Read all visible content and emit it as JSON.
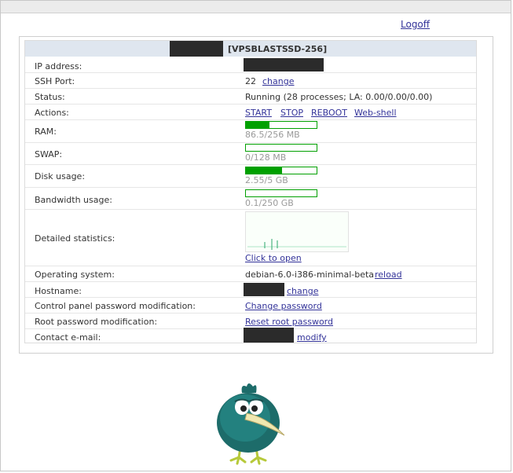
{
  "header": {
    "logoff": "Logoff",
    "vps_name": "[VPSBLASTSSD-256]"
  },
  "rows": {
    "ip": {
      "label": "IP address:"
    },
    "ssh": {
      "label": "SSH Port:",
      "value": "22",
      "change": "change"
    },
    "status": {
      "label": "Status:",
      "value": "Running (28 processes; LA: 0.00/0.00/0.00)"
    },
    "actions": {
      "label": "Actions:",
      "start": "START",
      "stop": "STOP",
      "reboot": "REBOOT",
      "webshell": "Web-shell"
    },
    "ram": {
      "label": "RAM:",
      "text": "86.5/256 MB",
      "used_fraction": 0.338
    },
    "swap": {
      "label": "SWAP:",
      "text": "0/128 MB",
      "used_fraction": 0.0
    },
    "disk": {
      "label": "Disk usage:",
      "text": "2.55/5 GB",
      "used_fraction": 0.51
    },
    "bandwidth": {
      "label": "Bandwidth usage:",
      "text": "0.1/250 GB",
      "used_fraction": 0.0004
    },
    "stats": {
      "label": "Detailed statistics:",
      "open": "Click to open"
    },
    "os": {
      "label": "Operating system:",
      "value": "debian-6.0-i386-minimal-beta",
      "reload": "reload"
    },
    "hostname": {
      "label": "Hostname:",
      "change": "change"
    },
    "cp_password": {
      "label": "Control panel password modification:",
      "link": "Change password"
    },
    "root_password": {
      "label": "Root password modification:",
      "link": "Reset root password"
    },
    "email": {
      "label": "Contact e-mail:",
      "modify": "modify"
    }
  },
  "colors": {
    "bar": "#00a000",
    "link": "#333399",
    "header_bg": "#dfe6ef"
  },
  "icons": {
    "mascot": "teal-bird-mascot-icon"
  }
}
